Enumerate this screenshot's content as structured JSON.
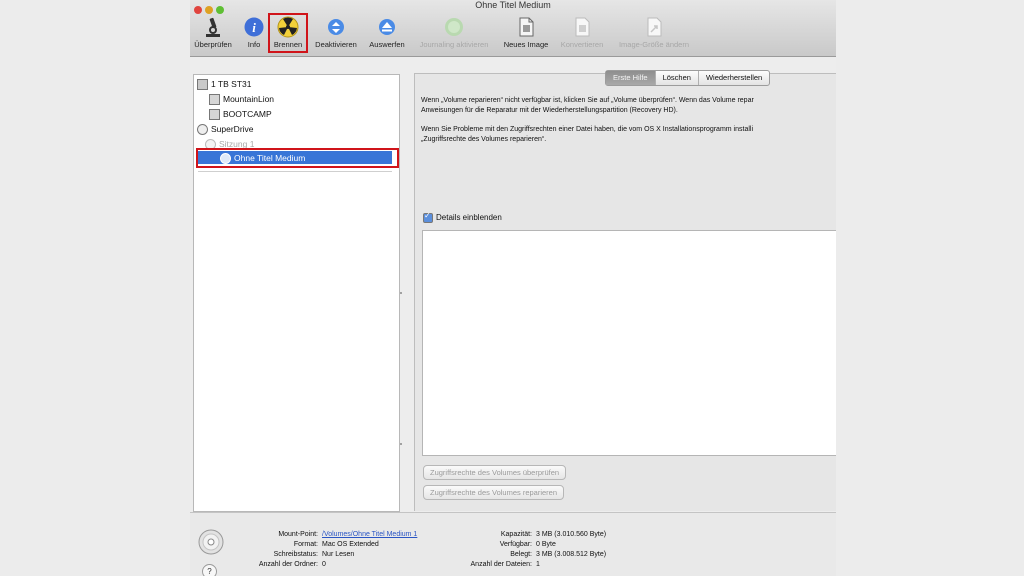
{
  "window": {
    "title": "Ohne Titel Medium"
  },
  "colors": {
    "accent": "#3875d7",
    "highlight": "#d0141a"
  },
  "toolbar": {
    "items": [
      {
        "label": "Überprüfen",
        "icon": "microscope-icon",
        "enabled": true
      },
      {
        "label": "Info",
        "icon": "info-icon",
        "enabled": true
      },
      {
        "label": "Brennen",
        "icon": "burn-icon",
        "enabled": true
      },
      {
        "label": "Deaktivieren",
        "icon": "unmount-icon",
        "enabled": true
      },
      {
        "label": "Auswerfen",
        "icon": "eject-icon",
        "enabled": true
      },
      {
        "label": "Journaling aktivieren",
        "icon": "journaling-icon",
        "enabled": false
      },
      {
        "label": "Neues Image",
        "icon": "new-image-icon",
        "enabled": true
      },
      {
        "label": "Konvertieren",
        "icon": "convert-icon",
        "enabled": false
      },
      {
        "label": "Image-Größe ändern",
        "icon": "resize-image-icon",
        "enabled": false
      }
    ]
  },
  "sidebar": {
    "items": [
      {
        "label": "1 TB ST31",
        "icon": "hard-disk-icon"
      },
      {
        "label": "MountainLion",
        "icon": "volume-icon"
      },
      {
        "label": "BOOTCAMP",
        "icon": "volume-icon"
      },
      {
        "label": "SuperDrive",
        "icon": "optical-drive-icon"
      },
      {
        "label": "Sitzung 1",
        "icon": "session-icon"
      },
      {
        "label": "Ohne Titel Medium",
        "icon": "disc-icon"
      }
    ]
  },
  "tabs": [
    "Erste Hilfe",
    "Löschen",
    "Wiederherstellen"
  ],
  "help": {
    "line1": "Wenn „Volume reparieren“ nicht verfügbar ist, klicken Sie auf „Volume überprüfen“. Wenn das Volume repar",
    "line2": "Anweisungen für die Reparatur mit der Wiederherstellungspartition (Recovery HD).",
    "line3": "Wenn Sie Probleme mit den Zugriffsrechten einer Datei haben, die vom OS X Installationsprogramm installi",
    "line4": "„Zugriffsrechte des Volumes reparieren“."
  },
  "details_label": "Details einblenden",
  "buttons": {
    "verify_permissions": "Zugriffsrechte des Volumes überprüfen",
    "repair_permissions": "Zugriffsrechte des Volumes reparieren"
  },
  "info": {
    "mount_point_label": "Mount-Point:",
    "mount_point_value": "/Volumes/Ohne Titel Medium 1",
    "format_label": "Format:",
    "format_value": "Mac OS Extended",
    "write_status_label": "Schreibstatus:",
    "write_status_value": "Nur Lesen",
    "folder_count_label": "Anzahl der Ordner:",
    "folder_count_value": "0",
    "capacity_label": "Kapazität:",
    "capacity_value": "3 MB (3.010.560 Byte)",
    "available_label": "Verfügbar:",
    "available_value": "0 Byte",
    "used_label": "Belegt:",
    "used_value": "3 MB (3.008.512 Byte)",
    "file_count_label": "Anzahl der Dateien:",
    "file_count_value": "1"
  },
  "help_button_label": "?"
}
